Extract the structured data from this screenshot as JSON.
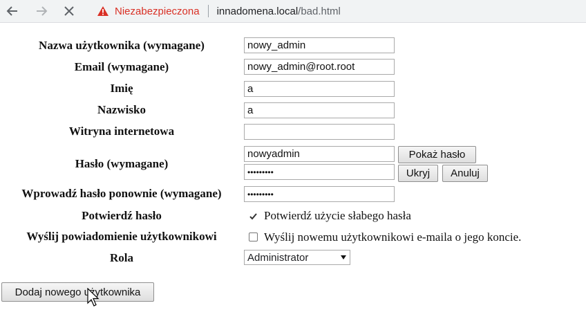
{
  "browser": {
    "security_label": "Niezabezpieczona",
    "url_host": "innadomena.local",
    "url_path": "/bad.html"
  },
  "form": {
    "username_label": "Nazwa użytkownika (wymagane)",
    "username_value": "nowy_admin",
    "email_label": "Email (wymagane)",
    "email_value": "nowy_admin@root.root",
    "firstname_label": "Imię",
    "firstname_value": "a",
    "lastname_label": "Nazwisko",
    "lastname_value": "a",
    "website_label": "Witryna internetowa",
    "website_value": "",
    "password_label": "Hasło (wymagane)",
    "password_plain_value": "nowyadmin",
    "password_masked_value": "•••••••••",
    "show_password_button": "Pokaż hasło",
    "hide_button": "Ukryj",
    "cancel_button": "Anuluj",
    "password_repeat_label": "Wprowadź hasło ponownie (wymagane)",
    "password_repeat_value": "•••••••••",
    "confirm_label": "Potwierdź hasło",
    "confirm_weak_text": "Potwierdź użycie słabego hasła",
    "confirm_weak_checked": true,
    "notify_label": "Wyślij powiadomienie użytkownikowi",
    "notify_text": "Wyślij nowemu użytkownikowi e-maila o jego koncie.",
    "notify_checked": false,
    "role_label": "Rola",
    "role_value": "Administrator",
    "submit_button": "Dodaj nowego użytkownika"
  }
}
